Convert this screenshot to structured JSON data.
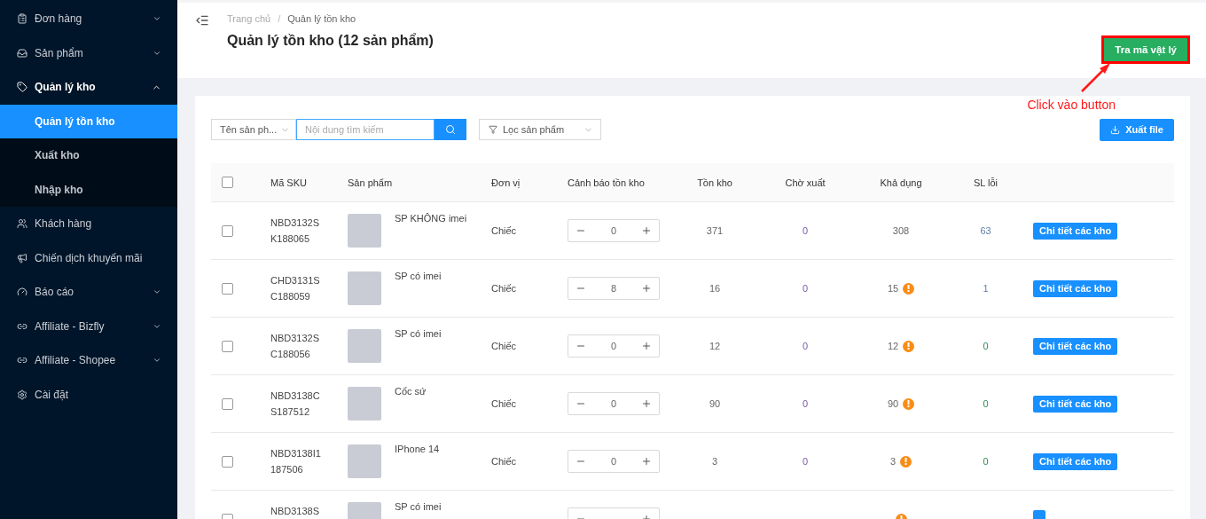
{
  "sidebar": {
    "items": [
      {
        "kind": "orders",
        "label": "Đơn hàng",
        "expandable": true,
        "expanded": false
      },
      {
        "kind": "products",
        "label": "Sản phẩm",
        "expandable": true,
        "expanded": false
      },
      {
        "kind": "warehouse",
        "label": "Quản lý kho",
        "expandable": true,
        "expanded": true,
        "children": [
          {
            "label": "Quản lý tồn kho",
            "selected": true
          },
          {
            "label": "Xuất kho",
            "selected": false
          },
          {
            "label": "Nhập kho",
            "selected": false
          }
        ]
      },
      {
        "kind": "customers",
        "label": "Khách hàng",
        "expandable": false,
        "expanded": false
      },
      {
        "kind": "campaigns",
        "label": "Chiến dịch khuyến mãi",
        "expandable": false,
        "expanded": false
      },
      {
        "kind": "reports",
        "label": "Báo cáo",
        "expandable": true,
        "expanded": false
      },
      {
        "kind": "affiliate",
        "label": "Affiliate - Bizfly",
        "expandable": true,
        "expanded": false
      },
      {
        "kind": "affiliate",
        "label": "Affiliate - Shopee",
        "expandable": true,
        "expanded": false
      },
      {
        "kind": "settings",
        "label": "Cài đặt",
        "expandable": false,
        "expanded": false
      }
    ]
  },
  "breadcrumb": [
    "Trang chủ",
    "Quản lý tồn kho"
  ],
  "breadcrumb_separator": "/",
  "page_title": "Quản lý tồn kho (12 sản phẩm)",
  "lookup_button": {
    "label": "Tra mã vật lý",
    "highlighted": true
  },
  "annotation": {
    "text": "Click vào button"
  },
  "filters": {
    "search_by": "Tên sản ph...",
    "search_placeholder": "Nội dung tìm kiếm",
    "filter": "Lọc sản phẩm"
  },
  "export_button": "Xuất file",
  "table": {
    "select_all": false,
    "columns": [
      "Mã SKU",
      "Sản phẩm",
      "Đơn vị",
      "Cảnh báo tồn kho",
      "Tồn kho",
      "Chờ xuất",
      "Khả dụng",
      "SL lỗi"
    ],
    "rows": [
      {
        "checked": false,
        "sku": "NBD3132S\nK188065",
        "product": "SP KHÔNG imei",
        "unit": "Chiếc",
        "alert": "0",
        "stock": "371",
        "pending": "0",
        "available": "308",
        "warning": false,
        "defects": "63",
        "action": "Chi tiết các kho"
      },
      {
        "checked": false,
        "sku": "CHD3131S\nC188059",
        "product": "SP có imei",
        "unit": "Chiếc",
        "alert": "8",
        "stock": "16",
        "pending": "0",
        "available": "15",
        "warning": true,
        "defects": "1",
        "action": "Chi tiết các kho"
      },
      {
        "checked": false,
        "sku": "NBD3132S\nC188056",
        "product": "SP có imei",
        "unit": "Chiếc",
        "alert": "0",
        "stock": "12",
        "pending": "0",
        "available": "12",
        "warning": true,
        "defects": "0",
        "action": "Chi tiết các kho"
      },
      {
        "checked": false,
        "sku": "NBD3138C\nS187512",
        "product": "Cốc sứ",
        "unit": "Chiếc",
        "alert": "0",
        "stock": "90",
        "pending": "0",
        "available": "90",
        "warning": true,
        "defects": "0",
        "action": "Chi tiết các kho"
      },
      {
        "checked": false,
        "sku": "NBD3138I1\n187506",
        "product": "IPhone 14",
        "unit": "Chiếc",
        "alert": "0",
        "stock": "3",
        "pending": "0",
        "available": "3",
        "warning": true,
        "defects": "0",
        "action": "Chi tiết các kho"
      },
      {
        "checked": false,
        "sku": "NBD3138S",
        "product": "SP có imei",
        "warning": true
      }
    ]
  }
}
